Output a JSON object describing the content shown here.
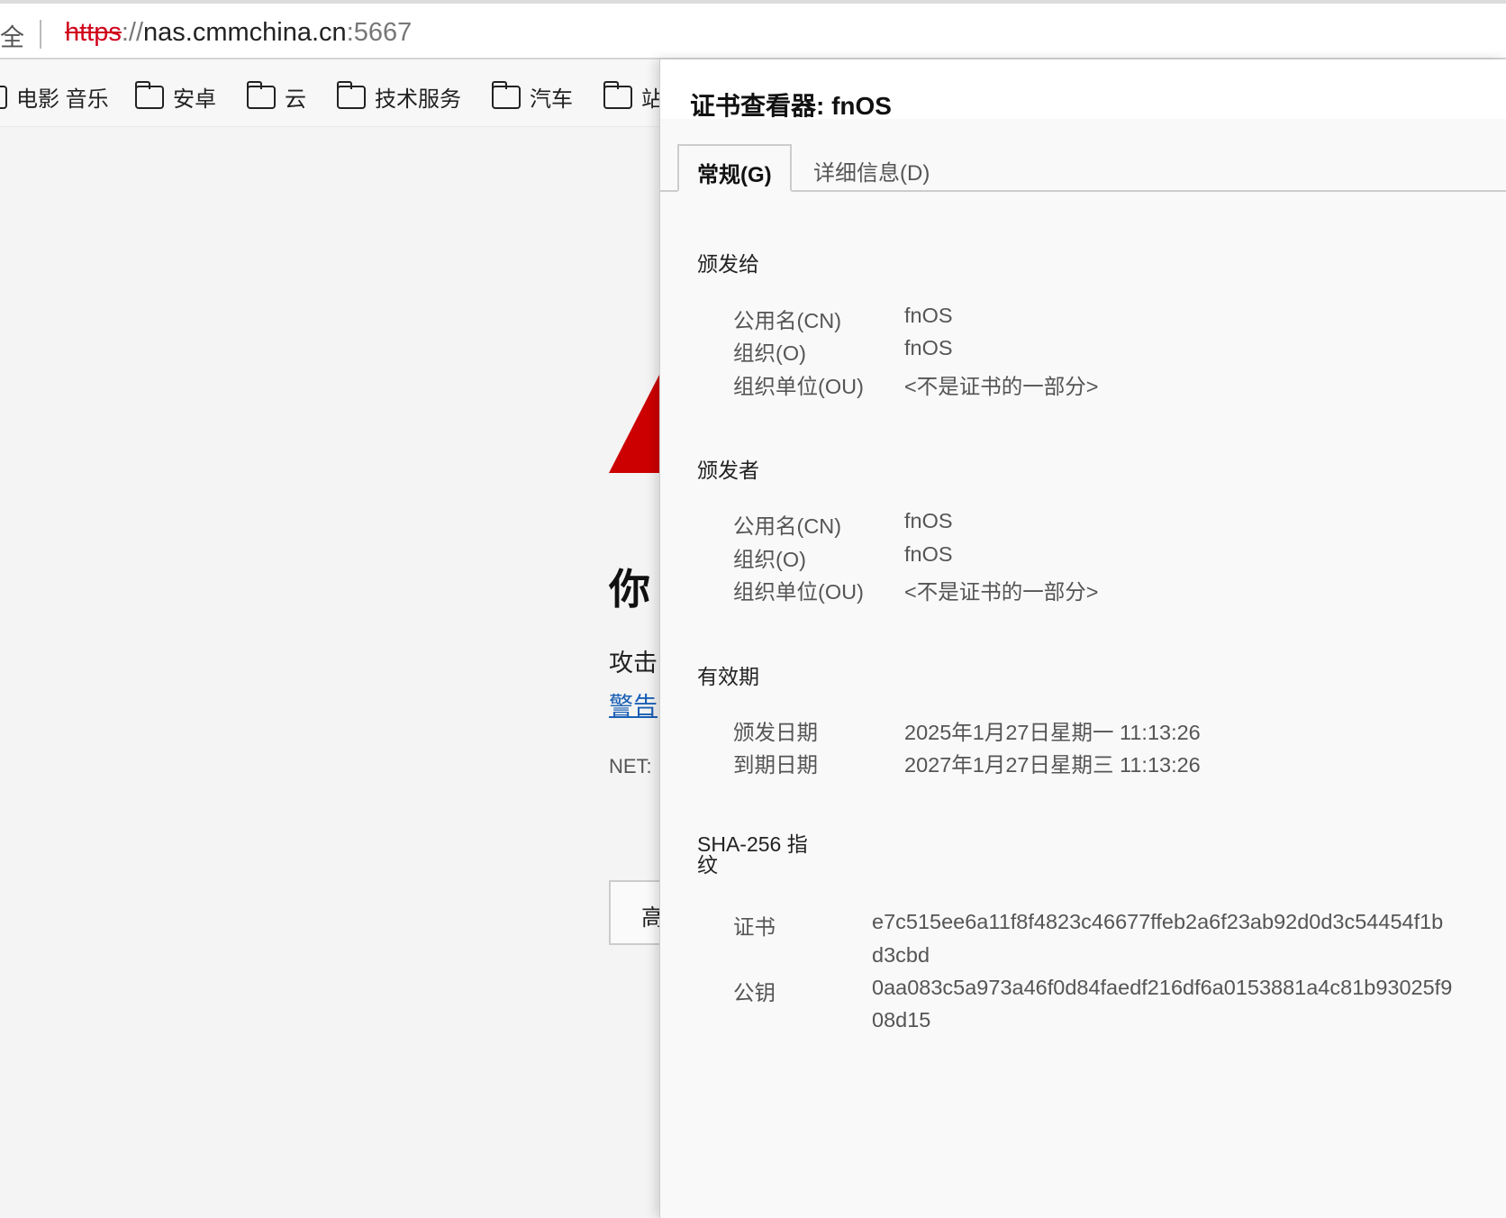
{
  "browser": {
    "security_label": "全",
    "url": {
      "scheme": "https",
      "sep": "://",
      "host": "nas.cmmchina.cn",
      "port": ":5667"
    },
    "bookmarks": [
      "电影 音乐",
      "安卓",
      "云",
      "技术服务",
      "汽车",
      "站"
    ]
  },
  "page": {
    "heading": "你",
    "text": "攻击",
    "link": "警告",
    "error_code": "NET:",
    "button": "高"
  },
  "dialog": {
    "title": "证书查看器: fnOS",
    "tabs": [
      {
        "label": "常规(G)",
        "active": true
      },
      {
        "label": "详细信息(D)",
        "active": false
      }
    ],
    "issued_to": {
      "heading": "颁发给",
      "rows": [
        [
          "公用名(CN)",
          "fnOS"
        ],
        [
          "组织(O)",
          "fnOS"
        ],
        [
          "组织单位(OU)",
          "<不是证书的一部分>"
        ]
      ]
    },
    "issued_by": {
      "heading": "颁发者",
      "rows": [
        [
          "公用名(CN)",
          "fnOS"
        ],
        [
          "组织(O)",
          "fnOS"
        ],
        [
          "组织单位(OU)",
          "<不是证书的一部分>"
        ]
      ]
    },
    "validity": {
      "heading": "有效期",
      "rows": [
        [
          "颁发日期",
          "2025年1月27日星期一 11:13:26"
        ],
        [
          "到期日期",
          "2027年1月27日星期三 11:13:26"
        ]
      ]
    },
    "fingerprints": {
      "heading_line1": "SHA-256 指",
      "heading_line2": "纹",
      "cert_label": "证书",
      "cert_line1": "e7c515ee6a11f8f4823c46677ffeb2a6f23ab92d0d3c54454f1b",
      "cert_line2": "d3cbd",
      "key_label": "公钥",
      "key_line1": "0aa083c5a973a46f0d84faedf216df6a0153881a4c81b93025f9",
      "key_line2": "08d15"
    }
  }
}
